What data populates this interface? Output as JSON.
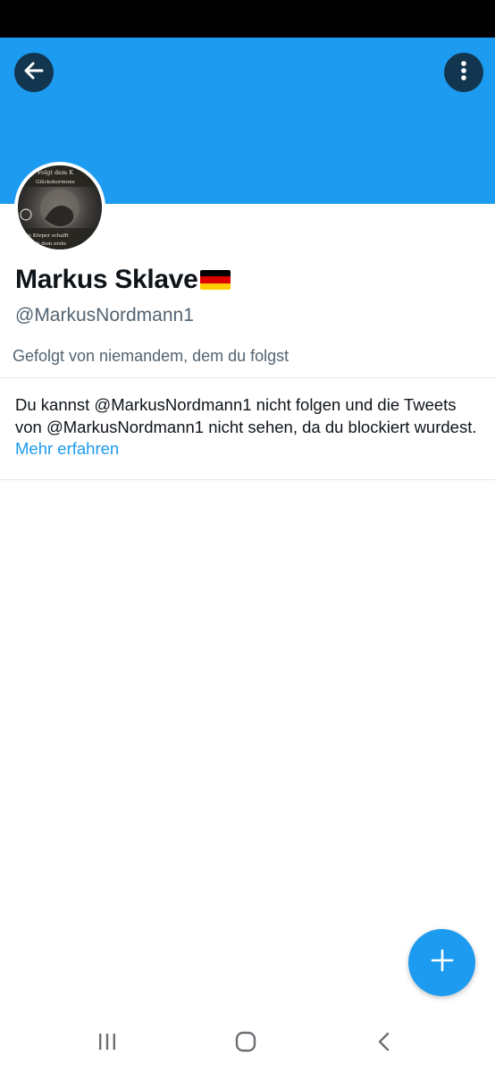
{
  "status_bar": {},
  "header": {
    "back_icon": "arrow-left-icon",
    "more_icon": "vertical-dots-icon",
    "banner_color": "#1d9bf0"
  },
  "profile": {
    "display_name": "Markus Sklave",
    "flag_icon": "german-flag-icon",
    "handle": "@MarkusNordmann1",
    "followed_by": "Gefolgt von niemandem, dem du folgst",
    "avatar_text": [
      "Folgt dem K",
      "Glückshormone",
      "Dein Körper schafft",
      "dir ab dem erste"
    ]
  },
  "blocked": {
    "message": "Du kannst @MarkusNordmann1 nicht folgen und die Tweets von @MarkusNordmann1 nicht sehen, da du blockiert wurdest.",
    "link": "Mehr erfahren"
  },
  "fab": {
    "icon": "plus-icon"
  },
  "nav_bar": {
    "recent_icon": "recent-apps-icon",
    "home_icon": "home-icon",
    "back_icon": "back-chevron-icon"
  },
  "colors": {
    "accent": "#1d9bf0",
    "text": "#0f1419",
    "secondary": "#536471"
  }
}
